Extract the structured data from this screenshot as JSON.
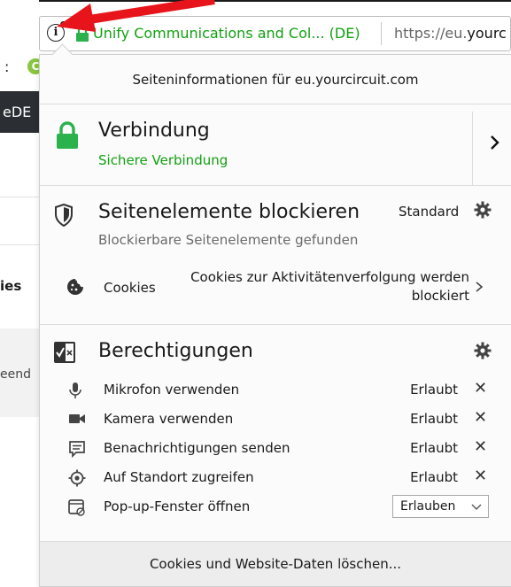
{
  "background": {
    "colon": ":",
    "badge_letter": "C",
    "dark_text": "eDE",
    "cies_text": "ies",
    "eend_text": "eend"
  },
  "urlbar": {
    "org_name": "Unify Communications and Col... (DE)",
    "url_prefix": "https://eu.",
    "url_domain": "yourc"
  },
  "panel": {
    "title": "Seiteninformationen für eu.yourcircuit.com",
    "connection": {
      "title": "Verbindung",
      "status": "Sichere Verbindung"
    },
    "blocking": {
      "title": "Seitenelemente blockieren",
      "mode": "Standard",
      "subtitle": "Blockierbare Seitenelemente gefunden",
      "cookies_label": "Cookies",
      "cookies_value": "Cookies zur Aktivitätenverfolgung werden blockiert"
    },
    "permissions": {
      "title": "Berechtigungen",
      "items": [
        {
          "label": "Mikrofon verwenden",
          "state": "Erlaubt",
          "icon": "microphone-icon"
        },
        {
          "label": "Kamera verwenden",
          "state": "Erlaubt",
          "icon": "camera-icon"
        },
        {
          "label": "Benachrichtigungen senden",
          "state": "Erlaubt",
          "icon": "notification-icon"
        },
        {
          "label": "Auf Standort zugreifen",
          "state": "Erlaubt",
          "icon": "location-icon"
        },
        {
          "label": "Pop-up-Fenster öffnen",
          "state": "Erlauben",
          "icon": "popup-icon"
        }
      ]
    },
    "footer": "Cookies und Website-Daten löschen..."
  },
  "colors": {
    "secure_green": "#12a012",
    "arrow_red": "#e8141b",
    "lock_green": "#2bb24c"
  }
}
